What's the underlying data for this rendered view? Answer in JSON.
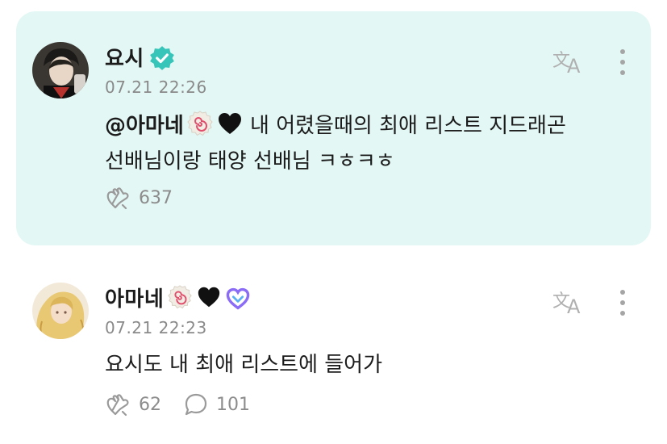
{
  "post": {
    "author": "요시",
    "timestamp": "07.21 22:26",
    "mention": "@아마네",
    "text_line1": "내 어렸을때의 최애 리스트 지드래곤",
    "text_line2": "선배님이랑 태양 선배님 ㅋㅎㅋㅎ",
    "like_count": "637",
    "verified": true
  },
  "reply": {
    "author": "아마네",
    "timestamp": "07.21 22:23",
    "text": "요시도 내 최애 리스트에 들어가",
    "like_count": "62",
    "comment_count": "101"
  },
  "icons": {
    "verified_badge": "verified-badge-icon",
    "translate": "translate-icon",
    "more": "more-vertical-icon",
    "like": "heart-hands-icon",
    "comment": "comment-bubble-icon"
  },
  "colors": {
    "highlight_bg": "#e3f7f4",
    "verified": "#36c5b8",
    "muted": "#8a8a8a",
    "badge_purple": "#8b6cf6"
  }
}
